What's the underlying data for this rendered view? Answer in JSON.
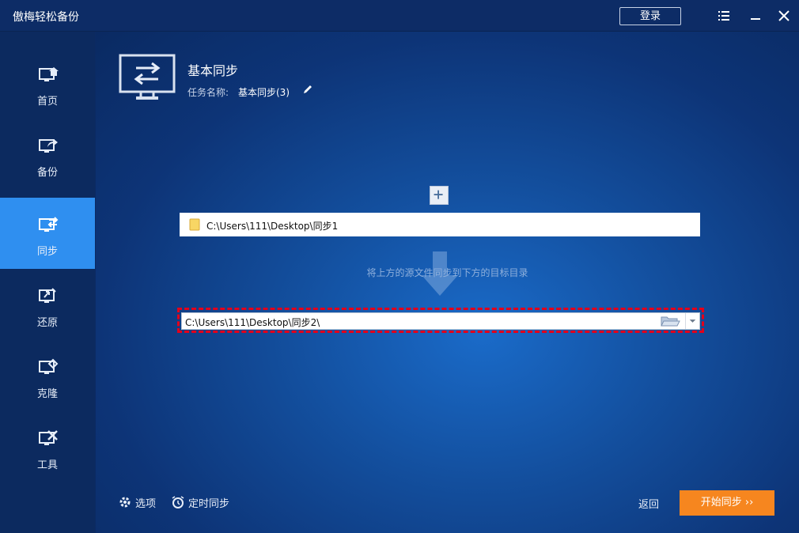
{
  "app": {
    "title": "傲梅轻松备份",
    "login_label": "登录"
  },
  "sidebar": {
    "items": [
      {
        "label": "首页",
        "icon": "home-monitor-icon",
        "active": false
      },
      {
        "label": "备份",
        "icon": "backup-monitor-icon",
        "active": false
      },
      {
        "label": "同步",
        "icon": "sync-monitor-icon",
        "active": true
      },
      {
        "label": "还原",
        "icon": "restore-monitor-icon",
        "active": false
      },
      {
        "label": "克隆",
        "icon": "clone-monitor-icon",
        "active": false
      },
      {
        "label": "工具",
        "icon": "tools-monitor-icon",
        "active": false
      }
    ]
  },
  "task": {
    "heading": "基本同步",
    "name_label": "任务名称:",
    "name_value": "基本同步(3)"
  },
  "source": {
    "path": "C:\\Users\\111\\Desktop\\同步1"
  },
  "hint": "将上方的源文件同步到下方的目标目录",
  "destination": {
    "path": "C:\\Users\\111\\Desktop\\同步2\\"
  },
  "footer": {
    "options_label": "选项",
    "schedule_label": "定时同步",
    "back_label": "返回",
    "start_label": "开始同步 ››"
  },
  "colors": {
    "accent": "#2f8ff0",
    "start_button": "#f6861f",
    "highlight": "#e3001b"
  }
}
